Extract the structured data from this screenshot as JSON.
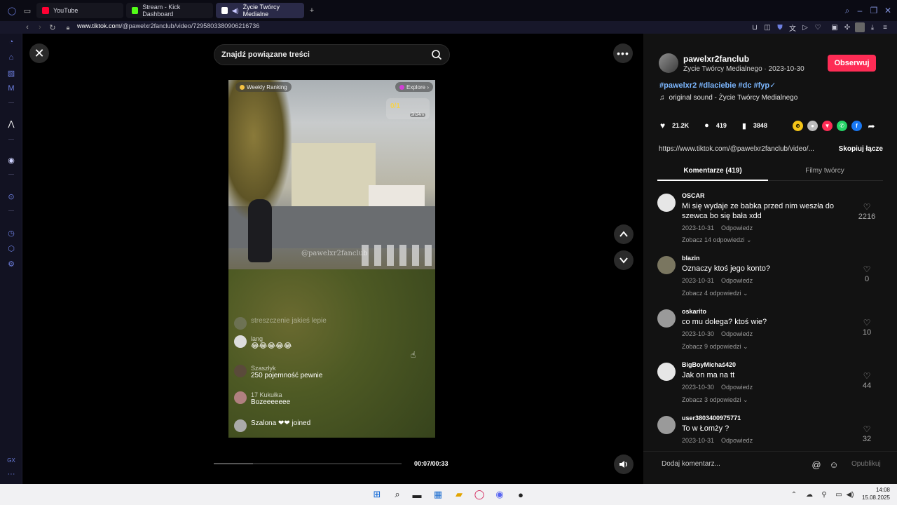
{
  "browser": {
    "tabs": [
      {
        "label": "YouTube",
        "color": "#ff0033"
      },
      {
        "label": "Stream - Kick Dashboard",
        "color": "#53fc18"
      },
      {
        "label": "Życie Twórcy Medialne",
        "color": "#ffffff"
      }
    ],
    "url_host": "www.tiktok.com",
    "url_path": "/@pawelxr2fanclub/video/7295803380906216736"
  },
  "viewer": {
    "search_placeholder": "Znajdź powiązane treści",
    "time": "00:07/00:33",
    "progress": 0.21
  },
  "video": {
    "weekly_ranking": "Weekly Ranking",
    "explore": "Explore ›",
    "score": "0/1",
    "score_time": "3h34m",
    "watermark": "@pawelxr2fanclub",
    "chat": [
      {
        "name": "",
        "msg": "streszczenie jakieś lepie"
      },
      {
        "name": "lang",
        "msg": "😂😂😂😂😂"
      },
      {
        "name": "Szaszłyk",
        "msg": "250 pojemność pewnie"
      },
      {
        "name": "17 Kukułka",
        "msg": "Bozeeeeeee"
      },
      {
        "name": "",
        "msg": "Szalona ❤❤ joined"
      }
    ]
  },
  "post": {
    "handle": "pawelxr2fanclub",
    "subline": "Życie Twórcy Medialnego · 2023-10-30",
    "follow": "Obserwuj",
    "hashtags": "#pawelxr2 #dlaciebie #dc #fyp✓",
    "sound": "original sound - Życie Twórcy Medialnego",
    "likes": "21.2K",
    "comments": "419",
    "saves": "3848",
    "link": "https://www.tiktok.com/@pawelxr2fanclub/video/...",
    "copy": "Skopiuj łącze"
  },
  "tabs": {
    "comments": "Komentarze (419)",
    "creator_videos": "Filmy twórcy"
  },
  "comments": [
    {
      "user": "OSCAR",
      "text": "Mi się wydaje ze babka przed nim weszła do szewca bo się bała xdd",
      "date": "2023-10-31",
      "reply": "Odpowiedz",
      "more": "Zobacz 14 odpowiedzi ⌄",
      "likes": "2216"
    },
    {
      "user": "blazin",
      "text": "Oznaczy ktoś jego konto?",
      "date": "2023-10-31",
      "reply": "Odpowiedz",
      "more": "Zobacz 4 odpowiedzi ⌄",
      "likes": "0"
    },
    {
      "user": "oskarito",
      "text": "co mu dolega? ktoś wie?",
      "date": "2023-10-30",
      "reply": "Odpowiedz",
      "more": "Zobacz 9 odpowiedzi ⌄",
      "likes": "10"
    },
    {
      "user": "BigBoyMichaś420",
      "text": "Jak on ma na tt",
      "date": "2023-10-30",
      "reply": "Odpowiedz",
      "more": "Zobacz 3 odpowiedzi ⌄",
      "likes": "44"
    },
    {
      "user": "user3803400975771",
      "text": "To w Łomży ?",
      "date": "2023-10-31",
      "reply": "Odpowiedz",
      "more": "",
      "likes": "32"
    }
  ],
  "add_comment": {
    "placeholder": "Dodaj komentarz...",
    "post": "Opublikuj"
  },
  "taskbar": {
    "time": "14:08",
    "date": "15.08.2025"
  },
  "sidebar": {
    "gx": "GX"
  }
}
